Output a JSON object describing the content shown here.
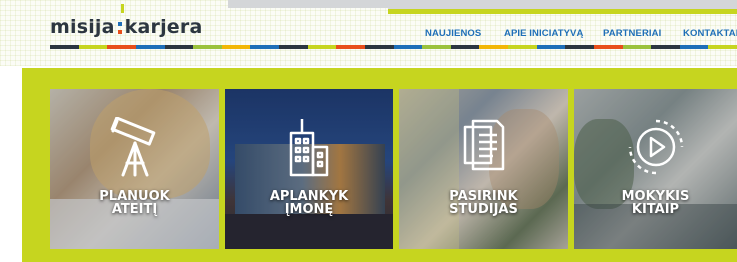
{
  "logo": {
    "part1": "misija",
    "part2": "karjera"
  },
  "nav": {
    "items": [
      {
        "label": "NAUJIENOS"
      },
      {
        "label": "APIE INICIATYVĄ"
      },
      {
        "label": "PARTNERIAI"
      },
      {
        "label": "KONTAKTAI"
      }
    ]
  },
  "tiles": [
    {
      "line1": "PLANUOK",
      "line2": "ATEITĮ",
      "icon": "telescope-icon"
    },
    {
      "line1": "APLANKYK",
      "line2": "ĮMONĘ",
      "icon": "building-icon"
    },
    {
      "line1": "PASIRINK",
      "line2": "STUDIJAS",
      "icon": "documents-icon"
    },
    {
      "line1": "MOKYKIS",
      "line2": "KITAIP",
      "icon": "play-video-icon"
    }
  ],
  "colors": {
    "accent": "#c6d51f",
    "nav": "#1f6fb8",
    "logo": "#2c3640"
  }
}
